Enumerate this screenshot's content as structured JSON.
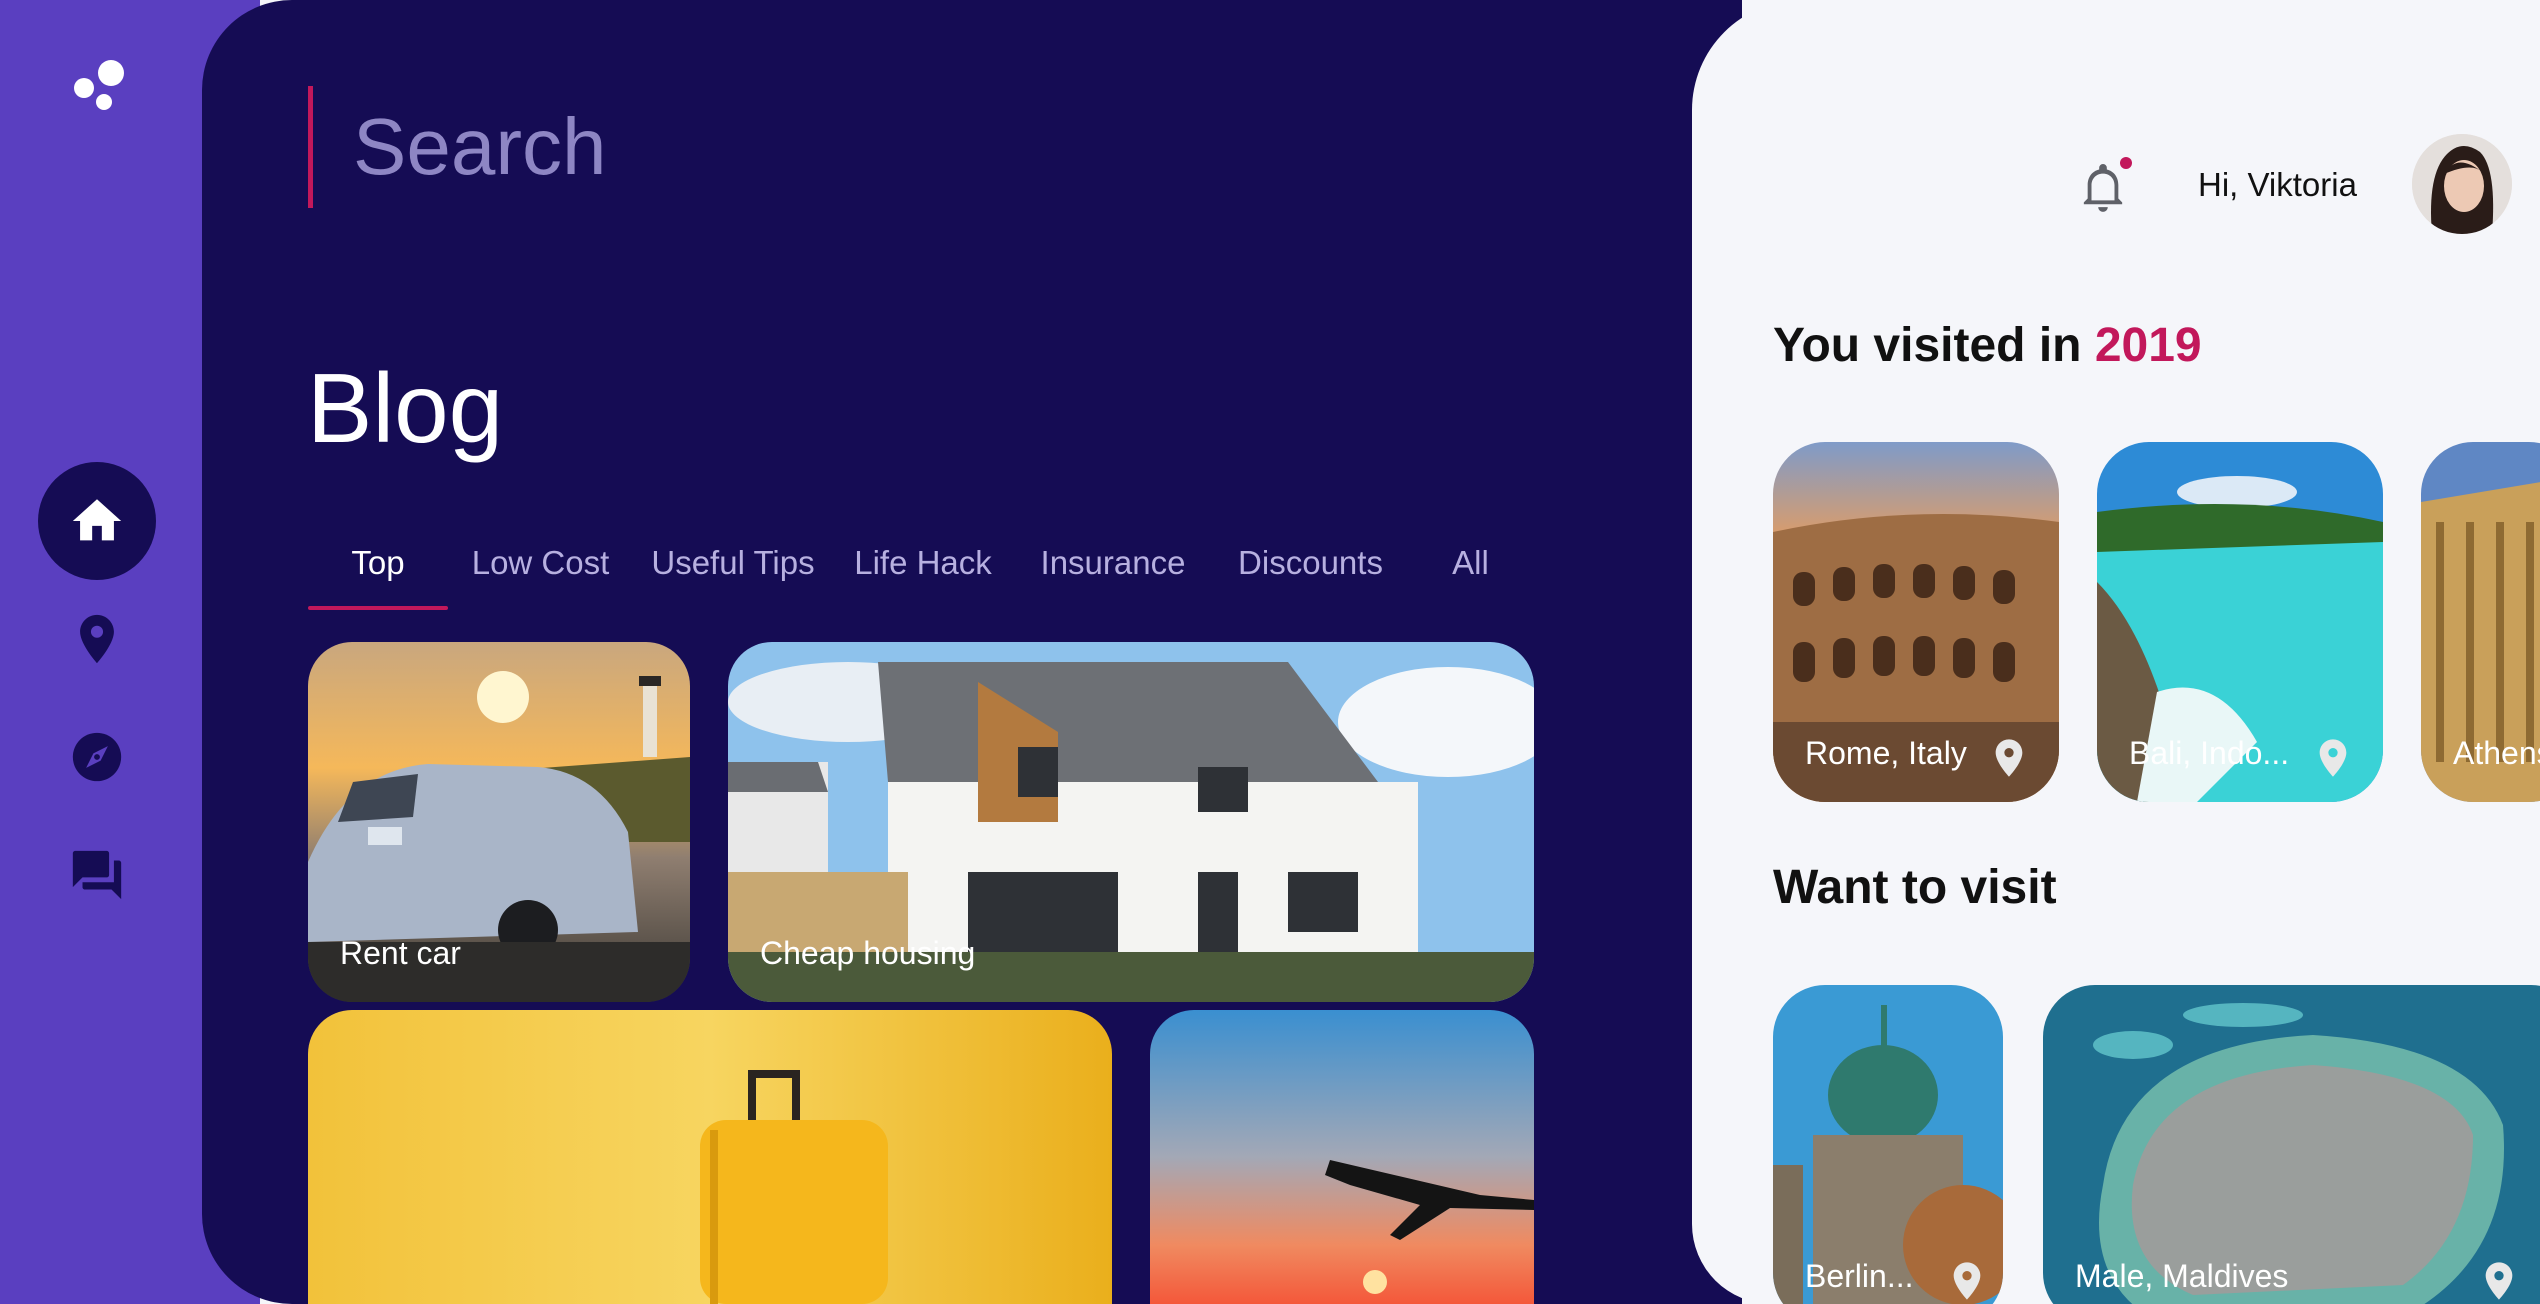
{
  "search": {
    "placeholder": "Search"
  },
  "blog": {
    "title": "Blog",
    "tabs": [
      "Top",
      "Low Cost",
      "Useful Tips",
      "Life Hack",
      "Insurance",
      "Discounts",
      "All"
    ],
    "active_tab": "Top",
    "cards": [
      {
        "label": "Rent car"
      },
      {
        "label": "Cheap housing"
      },
      {
        "label": ""
      },
      {
        "label": ""
      }
    ]
  },
  "nav": {
    "items": [
      {
        "icon": "home-icon",
        "active": true
      },
      {
        "icon": "location-pin-icon",
        "active": false
      },
      {
        "icon": "compass-icon",
        "active": false
      },
      {
        "icon": "chat-icon",
        "active": false
      }
    ]
  },
  "header": {
    "greeting": "Hi, Viktoria",
    "has_notification": true
  },
  "visited": {
    "title_prefix": "You visited in ",
    "year": "2019",
    "places": [
      {
        "label": "Rome, Italy"
      },
      {
        "label": "Bali, Indo..."
      },
      {
        "label": "Athens"
      }
    ]
  },
  "want": {
    "title": "Want to visit",
    "places": [
      {
        "label": "Berlin..."
      },
      {
        "label": "Male, Maldives"
      }
    ]
  },
  "colors": {
    "rail": "#5a3fc0",
    "main_bg": "#150c54",
    "accent": "#c2185b",
    "panel_bg": "#f5f6fa"
  }
}
